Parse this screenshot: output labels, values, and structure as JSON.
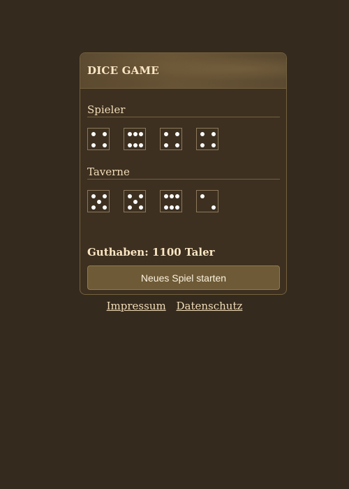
{
  "header": {
    "title": "DICE GAME"
  },
  "player": {
    "label": "Spieler",
    "dice": [
      4,
      6,
      4,
      4
    ]
  },
  "tavern": {
    "label": "Taverne",
    "dice": [
      5,
      5,
      6,
      2
    ]
  },
  "balance_text": "Guthaben: 1100 Taler",
  "start_button_label": "Neues Spiel starten",
  "footer": {
    "links": [
      "Impressum",
      "Datenschutz"
    ]
  },
  "colors": {
    "background": "#342a1e",
    "panel": "#3d3020",
    "accent": "#6e5a36",
    "text": "#f2ddb9"
  }
}
